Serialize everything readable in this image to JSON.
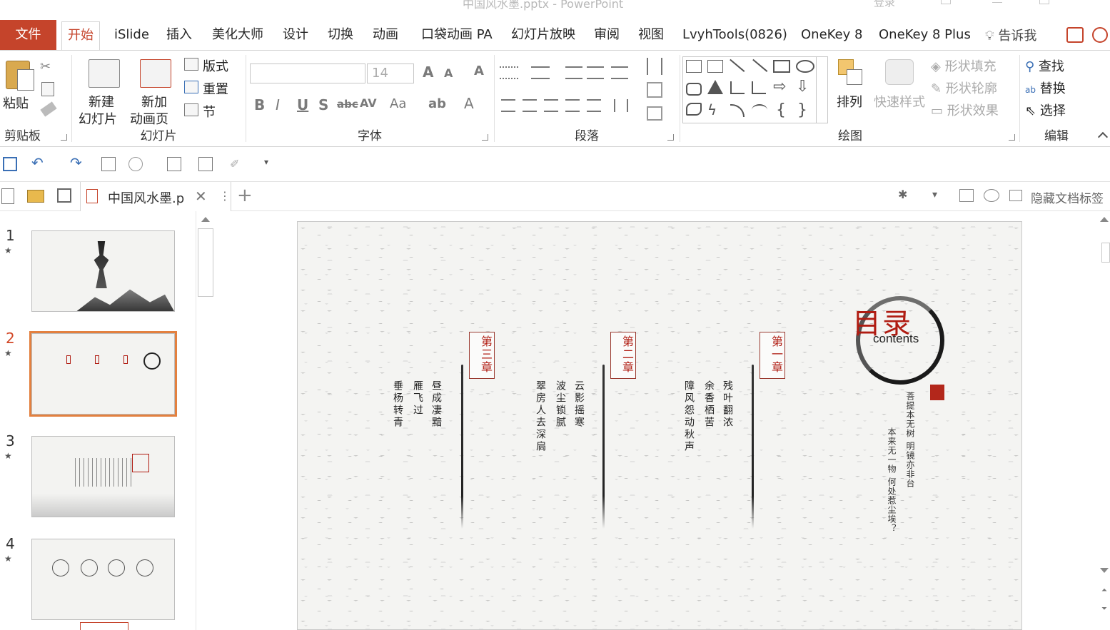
{
  "window": {
    "title": "中国风水墨.pptx - PowerPoint",
    "login": "登录"
  },
  "tabs": [
    {
      "label": "文件"
    },
    {
      "label": "开始"
    },
    {
      "label": "iSlide"
    },
    {
      "label": "插入"
    },
    {
      "label": "美化大师"
    },
    {
      "label": "设计"
    },
    {
      "label": "切换"
    },
    {
      "label": "动画"
    },
    {
      "label": "口袋动画 PA"
    },
    {
      "label": "幻灯片放映"
    },
    {
      "label": "审阅"
    },
    {
      "label": "视图"
    },
    {
      "label": "LvyhTools(0826)"
    },
    {
      "label": "OneKey 8"
    },
    {
      "label": "OneKey 8 Plus"
    }
  ],
  "tell_me": "告诉我",
  "ribbon": {
    "clipboard": {
      "label": "剪贴板",
      "paste": "粘贴"
    },
    "slides": {
      "label": "幻灯片",
      "new_slide": "新建",
      "new_slide2": "幻灯片",
      "new_anim": "新加",
      "new_anim2": "动画页",
      "layout": "版式",
      "reset": "重置",
      "section": "节"
    },
    "font": {
      "label": "字体",
      "size": "14"
    },
    "paragraph": {
      "label": "段落"
    },
    "drawing": {
      "label": "绘图",
      "arrange": "排列",
      "quick_styles": "快速样式",
      "shape_fill": "形状填充",
      "shape_outline": "形状轮廓",
      "shape_effects": "形状效果"
    },
    "editing": {
      "label": "编辑",
      "find": "查找",
      "replace": "替换",
      "select": "选择"
    }
  },
  "doc_tab": {
    "name": "中国风水墨.p",
    "hide_tabs": "隐藏文档标签"
  },
  "thumbnails": [
    {
      "num": "1"
    },
    {
      "num": "2"
    },
    {
      "num": "3"
    },
    {
      "num": "4"
    }
  ],
  "slide": {
    "title": "目录",
    "subtitle": "contents",
    "chapters": [
      {
        "label": "第一章",
        "cols": [
          "残叶翻浓",
          "余香栖苦",
          "障风怨动秋声"
        ]
      },
      {
        "label": "第二章",
        "cols": [
          "云影摇寒",
          "波尘锁腻",
          "翠房人去深扃"
        ]
      },
      {
        "label": "第三章",
        "cols": [
          "昼成凄黯",
          "雁飞过",
          "垂杨转青"
        ]
      }
    ],
    "poem": [
      "菩提本无树 明镜亦非台",
      "本来无一物 何处惹尘埃？"
    ]
  },
  "colors": {
    "accent": "#c5442b",
    "seal_red": "#b01c12",
    "selection": "#e3803f"
  }
}
